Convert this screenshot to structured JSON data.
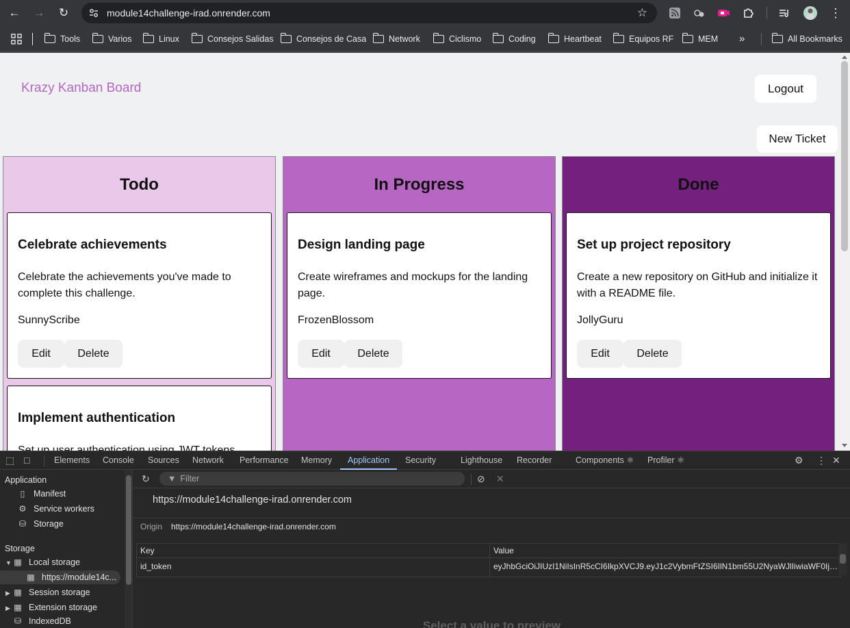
{
  "browser": {
    "url": "module14challenge-irad.onrender.com",
    "bookmarks": [
      "Tools",
      "Varios",
      "Linux",
      "Consejos Salidas",
      "Consejos de Casa",
      "Network",
      "Ciclismo",
      "Coding",
      "Heartbeat",
      "Equipos RF",
      "MEM"
    ],
    "all_bookmarks": "All Bookmarks",
    "icons": [
      "back-arrow-icon",
      "forward-arrow-icon",
      "reload-icon",
      "site-settings-icon",
      "star-icon",
      "rss-icon",
      "extension-icon",
      "puzzle-icon",
      "media-control-icon",
      "kebab-menu-icon"
    ]
  },
  "app": {
    "brand": "Krazy Kanban Board",
    "logout": "Logout",
    "new_ticket": "New Ticket",
    "colors": {
      "todo": "#e9c8ea",
      "in_progress": "#b866c4",
      "done": "#73207f",
      "brand": "#b865c6"
    },
    "columns": [
      {
        "title": "Todo",
        "cards": [
          {
            "title": "Celebrate achievements",
            "description": "Celebrate the achievements you've made to complete this challenge.",
            "user": "SunnyScribe",
            "edit": "Edit",
            "delete": "Delete"
          },
          {
            "title": "Implement authentication",
            "description": "Set up user authentication using JWT tokens"
          }
        ]
      },
      {
        "title": "In Progress",
        "cards": [
          {
            "title": "Design landing page",
            "description": "Create wireframes and mockups for the landing page.",
            "user": "FrozenBlossom",
            "edit": "Edit",
            "delete": "Delete"
          }
        ]
      },
      {
        "title": "Done",
        "cards": [
          {
            "title": "Set up project repository",
            "description": "Create a new repository on GitHub and initialize it with a README file.",
            "user": "JollyGuru",
            "edit": "Edit",
            "delete": "Delete"
          }
        ]
      }
    ]
  },
  "devtools": {
    "tabs": [
      "Elements",
      "Console",
      "Sources",
      "Network",
      "Performance",
      "Memory",
      "Application",
      "Security",
      "Lighthouse",
      "Recorder",
      "Components ⚛",
      "Profiler ⚛"
    ],
    "active_tab": "Application",
    "sidebar": {
      "application_header": "Application",
      "application_items": [
        "Manifest",
        "Service workers",
        "Storage"
      ],
      "storage_header": "Storage",
      "storage_items": [
        "Local storage",
        "https://module14c...",
        "Session storage",
        "Extension storage",
        "IndexedDB"
      ]
    },
    "filter_placeholder": "Filter",
    "origin_title": "https://module14challenge-irad.onrender.com",
    "origin_label": "Origin",
    "origin_value": "https://module14challenge-irad.onrender.com",
    "table": {
      "headers": [
        "Key",
        "Value"
      ],
      "rows": [
        {
          "key": "id_token",
          "value": "eyJhbGciOiJIUzI1NiIsInR5cCI6IkpXVCJ9.eyJ1c2VybmFtZSI6IlN1bm55U2NyaWJlIiwiaWF0IjoxNz..."
        }
      ]
    },
    "preview_empty": "Select a value to preview"
  }
}
